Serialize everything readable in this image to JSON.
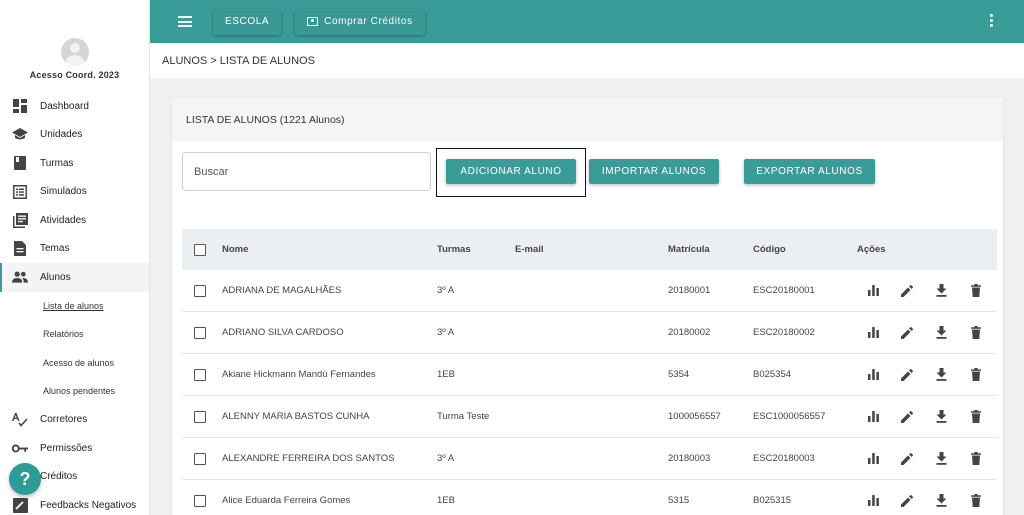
{
  "sidebar": {
    "profile_name": "Acesso Coord. 2023",
    "items": [
      {
        "label": "Dashboard",
        "icon": "dashboard-icon"
      },
      {
        "label": "Unidades",
        "icon": "school-icon"
      },
      {
        "label": "Turmas",
        "icon": "book-icon"
      },
      {
        "label": "Simulados",
        "icon": "list-icon"
      },
      {
        "label": "Atividades",
        "icon": "library-books-icon"
      },
      {
        "label": "Temas",
        "icon": "document-icon"
      },
      {
        "label": "Alunos",
        "icon": "people-icon"
      }
    ],
    "subitems": [
      "Lista de alunos",
      "Relatórios",
      "Acesso de alunos",
      "Alunos pendentes"
    ],
    "items_bottom": [
      {
        "label": "Corretores",
        "icon": "spellcheck-icon"
      },
      {
        "label": "Permissões",
        "icon": "key-icon"
      },
      {
        "label": "Créditos",
        "icon": "credits-icon"
      },
      {
        "label": "Feedbacks Negativos",
        "icon": "feedback-icon"
      }
    ],
    "help_label": "?"
  },
  "topbar": {
    "escola_label": "ESCOLA",
    "comprar_label": "Comprar Créditos"
  },
  "breadcrumb": "ALUNOS > LISTA DE ALUNOS",
  "card": {
    "title": "LISTA DE ALUNOS (1221 Alunos)",
    "search_placeholder": "Buscar",
    "add_label": "ADICIONAR ALUNO",
    "import_label": "IMPORTAR ALUNOS",
    "export_label": "EXPORTAR ALUNOS"
  },
  "table": {
    "headers": {
      "nome": "Nome",
      "turmas": "Turmas",
      "email": "E-mail",
      "matricula": "Matrícula",
      "codigo": "Código",
      "acoes": "Ações"
    },
    "rows": [
      {
        "nome": "ADRIANA DE MAGALHÃES",
        "turma": "3º A",
        "email": "",
        "matricula": "20180001",
        "codigo": "ESC20180001"
      },
      {
        "nome": "ADRIANO SILVA CARDOSO",
        "turma": "3º A",
        "email": "",
        "matricula": "20180002",
        "codigo": "ESC20180002"
      },
      {
        "nome": "Akiane Hickmann Mandú Fernandes",
        "turma": "1EB",
        "email": "",
        "matricula": "5354",
        "codigo": "B025354"
      },
      {
        "nome": "ALENNY MARIA BASTOS CUNHA",
        "turma": "Turma Teste",
        "email": "",
        "matricula": "1000056557",
        "codigo": "ESC1000056557"
      },
      {
        "nome": "ALEXANDRE FERREIRA DOS SANTOS",
        "turma": "3º A",
        "email": "",
        "matricula": "20180003",
        "codigo": "ESC20180003"
      },
      {
        "nome": "Alice Eduarda Ferreira Gomes",
        "turma": "1EB",
        "email": "",
        "matricula": "5315",
        "codigo": "B025315"
      }
    ]
  },
  "colors": {
    "primary": "#3a9c99",
    "background": "#eef0f2"
  }
}
